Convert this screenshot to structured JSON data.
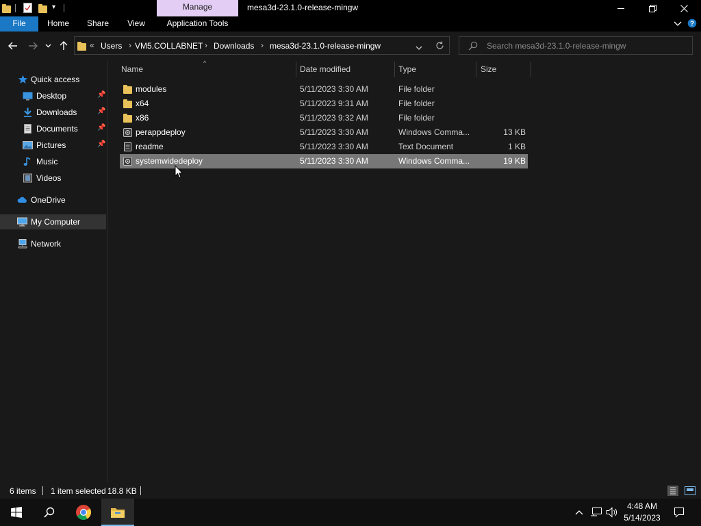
{
  "titlebar": {
    "manage_label": "Manage",
    "window_title": "mesa3d-23.1.0-release-mingw"
  },
  "ribbon": {
    "tabs": [
      {
        "label": "File"
      },
      {
        "label": "Home"
      },
      {
        "label": "Share"
      },
      {
        "label": "View"
      },
      {
        "label": "Application Tools"
      }
    ]
  },
  "address": {
    "overflow": "«",
    "crumbs": [
      "Users",
      "VM5.COLLABNET",
      "Downloads",
      "mesa3d-23.1.0-release-mingw"
    ]
  },
  "search": {
    "placeholder": "Search mesa3d-23.1.0-release-mingw"
  },
  "sidebar": {
    "items": [
      {
        "label": "Quick access",
        "icon": "star-icon"
      },
      {
        "label": "Desktop",
        "icon": "desktop-icon",
        "pinned": true
      },
      {
        "label": "Downloads",
        "icon": "download-arrow-icon",
        "pinned": true
      },
      {
        "label": "Documents",
        "icon": "document-icon",
        "pinned": true
      },
      {
        "label": "Pictures",
        "icon": "pictures-icon",
        "pinned": true
      },
      {
        "label": "Music",
        "icon": "music-note-icon"
      },
      {
        "label": "Videos",
        "icon": "video-icon"
      },
      {
        "label": "OneDrive",
        "icon": "cloud-icon"
      },
      {
        "label": "My Computer",
        "icon": "computer-icon",
        "selected": true
      },
      {
        "label": "Network",
        "icon": "network-icon"
      }
    ]
  },
  "columns": {
    "name": "Name",
    "date": "Date modified",
    "type": "Type",
    "size": "Size"
  },
  "files": [
    {
      "name": "modules",
      "date": "5/11/2023 3:30 AM",
      "type": "File folder",
      "size": "",
      "icon": "folder-icon"
    },
    {
      "name": "x64",
      "date": "5/11/2023 9:31 AM",
      "type": "File folder",
      "size": "",
      "icon": "folder-icon"
    },
    {
      "name": "x86",
      "date": "5/11/2023 9:32 AM",
      "type": "File folder",
      "size": "",
      "icon": "folder-icon"
    },
    {
      "name": "perappdeploy",
      "date": "5/11/2023 3:30 AM",
      "type": "Windows Comma...",
      "size": "13 KB",
      "icon": "cmd-script-icon"
    },
    {
      "name": "readme",
      "date": "5/11/2023 3:30 AM",
      "type": "Text Document",
      "size": "1 KB",
      "icon": "text-document-icon"
    },
    {
      "name": "systemwidedeploy",
      "date": "5/11/2023 3:30 AM",
      "type": "Windows Comma...",
      "size": "19 KB",
      "icon": "cmd-script-icon",
      "selected": true
    }
  ],
  "status": {
    "items_count": "6 items",
    "selection": "1 item selected",
    "selection_size": "18.8 KB"
  },
  "taskbar": {
    "time": "4:48 AM",
    "date": "5/14/2023"
  },
  "colors": {
    "file_tab": "#1a78c4",
    "manage_tab": "#e3cdf5",
    "selected_row": "#777777",
    "folder": "#e8c15a"
  }
}
